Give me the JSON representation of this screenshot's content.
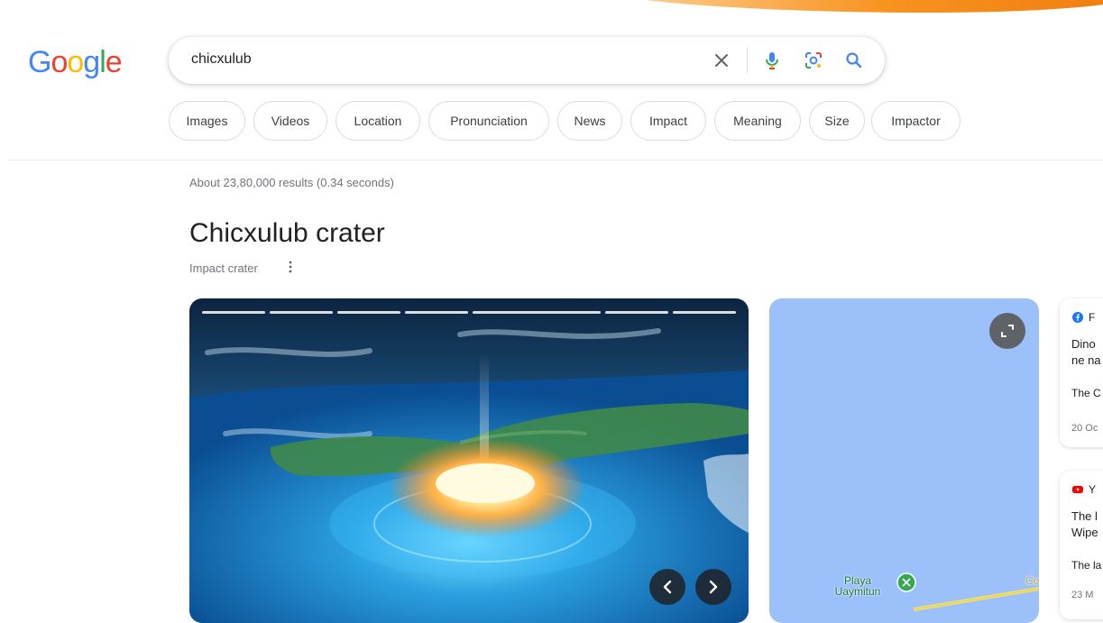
{
  "search": {
    "query": "chicxulub"
  },
  "logo": {
    "letters": [
      "G",
      "o",
      "o",
      "g",
      "l",
      "e"
    ],
    "colors": [
      "#4285F4",
      "#EA4335",
      "#FBBC05",
      "#4285F4",
      "#34A853",
      "#EA4335"
    ]
  },
  "icons": {
    "clear": "close-icon",
    "voice": "microphone-icon",
    "lens": "lens-icon",
    "search": "search-icon"
  },
  "chips": [
    "Images",
    "Videos",
    "Location",
    "Pronunciation",
    "News",
    "Impact",
    "Meaning",
    "Size",
    "Impactor"
  ],
  "stats": "About 23,80,000 results (0.34 seconds)",
  "knowledge_panel": {
    "title": "Chicxulub crater",
    "subtitle": "Impact crater"
  },
  "map": {
    "place_label_line1": "Playa",
    "place_label_line2": "Uaymitun",
    "partial_label": "Con"
  },
  "side_cards": [
    {
      "source": "F",
      "title_line1": "Dino",
      "title_line2": "ne na",
      "publisher": "The C",
      "date": "20 Oc"
    },
    {
      "source": "Y",
      "title_line1": "The l",
      "title_line2": "Wipe",
      "publisher": "The la",
      "date": "23 M"
    }
  ],
  "colors": {
    "accent": "#1a73e8",
    "map_water": "#9cc0f9",
    "orange_swoosh": "#f7931e"
  }
}
